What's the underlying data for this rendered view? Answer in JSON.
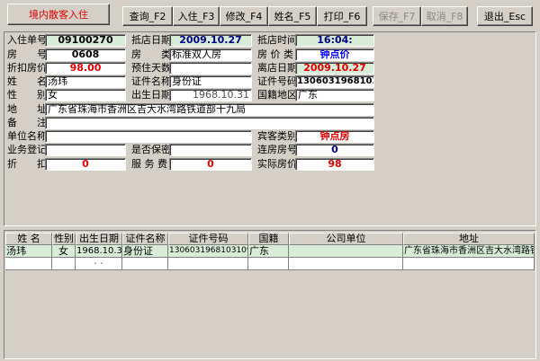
{
  "window": {
    "title": "境内散客入住"
  },
  "toolbar": {
    "query": "查询_F2",
    "checkin": "入住_F3",
    "modify": "修改_F4",
    "name": "姓名_F5",
    "print": "打印_F6",
    "save": "保存_F7",
    "cancel": "取消_F8",
    "exit": "退出_Esc"
  },
  "form": {
    "checkin_no": {
      "label": "入住单号",
      "value": "09100270"
    },
    "arrival_date": {
      "label": "抵店日期",
      "value": "2009.10.27"
    },
    "arrival_time": {
      "label": "抵店时间",
      "value": "16:04:"
    },
    "room_no": {
      "label": "房　　号",
      "value": "0608"
    },
    "room_type": {
      "label": "房　　类",
      "value": "标准双人房"
    },
    "room_price_type": {
      "label": "房 价 类",
      "value": "钟点价"
    },
    "discount_price": {
      "label": "折扣房价",
      "value": "98.00"
    },
    "planned_days": {
      "label": "预住天数",
      "value": ""
    },
    "departure_date": {
      "label": "离店日期",
      "value": "2009.10.27"
    },
    "name": {
      "label": "姓　　名",
      "value": "汤玮"
    },
    "id_type": {
      "label": "证件名称",
      "value": "身份证"
    },
    "id_no": {
      "label": "证件号码",
      "value": "130603196810310923"
    },
    "gender": {
      "label": "性　　别",
      "value": "女"
    },
    "birth_date": {
      "label": "出生日期",
      "value": "1968.10.31"
    },
    "nationality": {
      "label": "国籍地区",
      "value": "广东"
    },
    "address": {
      "label": "地　　址",
      "value": "广东省珠海市香洲区吉大水湾路铁道部十九局"
    },
    "remark": {
      "label": "备　　注",
      "value": ""
    },
    "company": {
      "label": "单位名称",
      "value": ""
    },
    "guest_category": {
      "label": "宾客类别",
      "value": "钟点房"
    },
    "business_reg": {
      "label": "业务登记",
      "value": ""
    },
    "confidential": {
      "label": "是否保密",
      "value": ""
    },
    "linked_rooms": {
      "label": "连房房号",
      "value": "0"
    },
    "discount": {
      "label": "折　　扣",
      "value": "0"
    },
    "service_fee": {
      "label": "服 务 费",
      "value": "0"
    },
    "actual_price": {
      "label": "实际房价",
      "value": "98"
    }
  },
  "table": {
    "columns": [
      "姓 名",
      "性别",
      "出生日期",
      "证件名称",
      "证件号码",
      "国籍",
      "公司单位",
      "地址"
    ],
    "rows": [
      [
        "汤玮",
        "女",
        "1968.10.31",
        "身份证",
        "130603196810310923",
        "广东",
        "",
        "广东省珠海市香洲区吉大水湾路铁"
      ],
      [
        "",
        "",
        "·  ·",
        "",
        "",
        "",
        "",
        ""
      ]
    ]
  }
}
